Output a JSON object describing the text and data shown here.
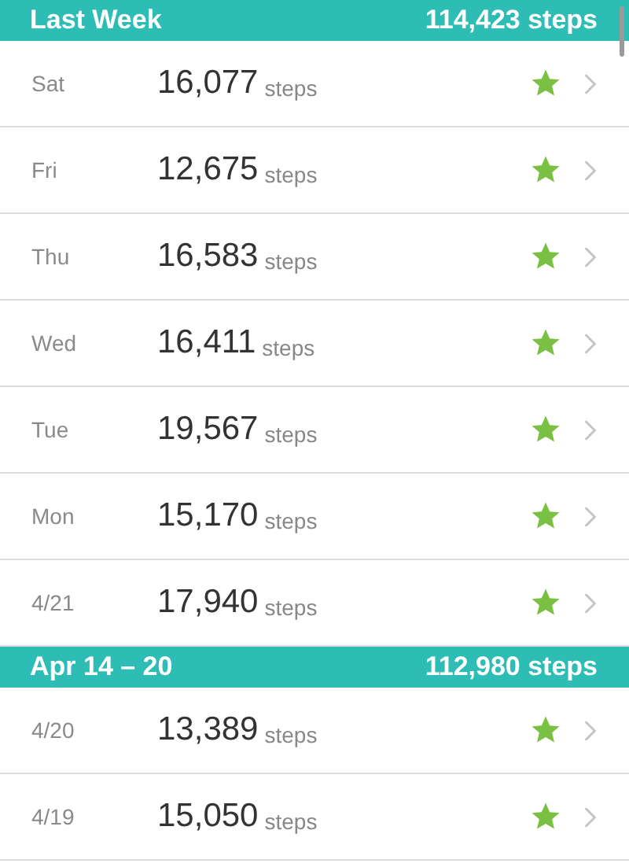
{
  "sections": [
    {
      "title": "Last Week",
      "total": "114,423 steps",
      "days": [
        {
          "label": "Sat",
          "count": "16,077",
          "unit": "steps",
          "goal_met": true
        },
        {
          "label": "Fri",
          "count": "12,675",
          "unit": "steps",
          "goal_met": true
        },
        {
          "label": "Thu",
          "count": "16,583",
          "unit": "steps",
          "goal_met": true
        },
        {
          "label": "Wed",
          "count": "16,411",
          "unit": "steps",
          "goal_met": true
        },
        {
          "label": "Tue",
          "count": "19,567",
          "unit": "steps",
          "goal_met": true
        },
        {
          "label": "Mon",
          "count": "15,170",
          "unit": "steps",
          "goal_met": true
        },
        {
          "label": "4/21",
          "count": "17,940",
          "unit": "steps",
          "goal_met": true
        }
      ]
    },
    {
      "title": "Apr 14 – 20",
      "total": "112,980 steps",
      "days": [
        {
          "label": "4/20",
          "count": "13,389",
          "unit": "steps",
          "goal_met": true
        },
        {
          "label": "4/19",
          "count": "15,050",
          "unit": "steps",
          "goal_met": true
        }
      ]
    }
  ]
}
